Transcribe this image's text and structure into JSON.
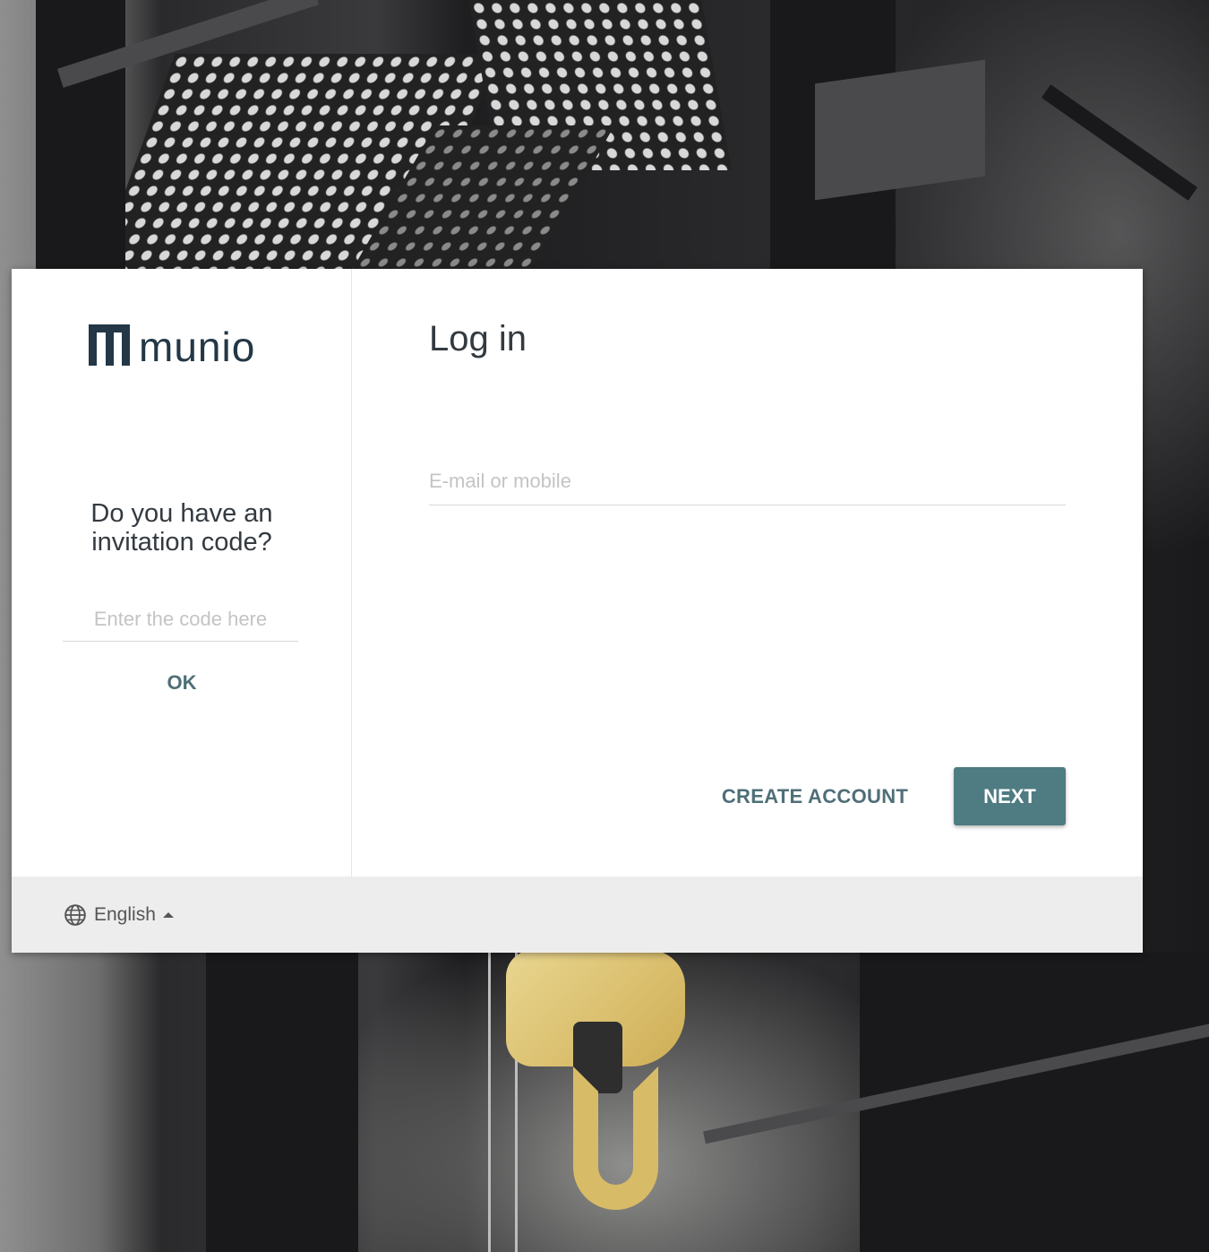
{
  "brand": {
    "name": "munio"
  },
  "invitation": {
    "title": "Do you have an invitation code?",
    "placeholder": "Enter the code here",
    "value": "",
    "ok_label": "OK"
  },
  "login": {
    "title": "Log in",
    "email_placeholder": "E-mail or mobile",
    "email_value": "",
    "create_account_label": "CREATE ACCOUNT",
    "next_label": "NEXT"
  },
  "footer": {
    "language": "English",
    "language_icon": "globe-icon"
  },
  "colors": {
    "accent": "#4f7b82",
    "link": "#4f6f77",
    "brand": "#233746"
  }
}
